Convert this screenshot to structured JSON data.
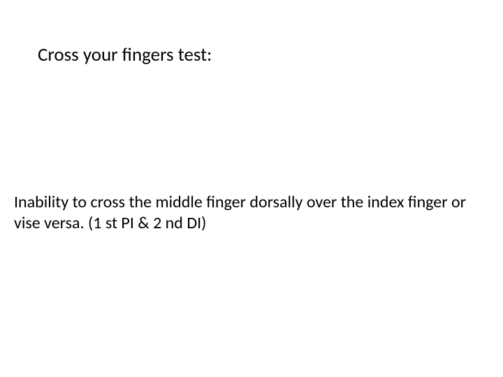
{
  "title": "Cross your fingers test:",
  "body": "Inability to cross the middle  finger dorsally over the index finger or vise  versa. (1 st PI & 2 nd DI)"
}
